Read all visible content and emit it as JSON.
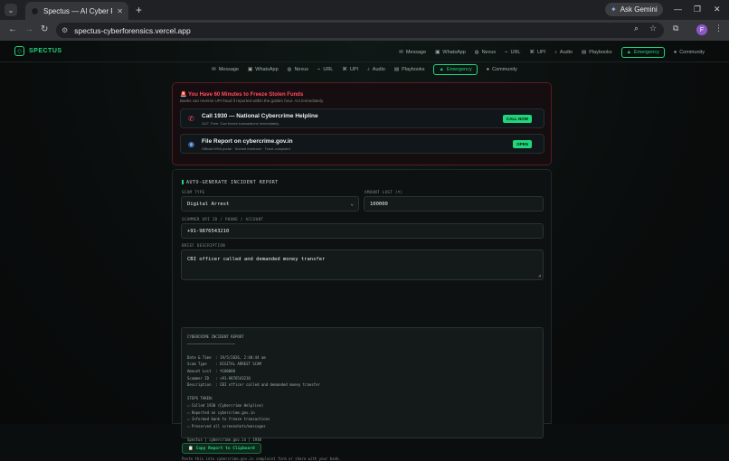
{
  "browser": {
    "tab_title": "Spectus — AI Cyber Forensics P",
    "tab_close": "✕",
    "new_tab": "+",
    "gemini_label": "Ask Gemini",
    "url": "spectus-cyberforensics.vercel.app",
    "profile_initial": "F"
  },
  "app": {
    "logo_icon": "shield",
    "logo_text": "SPECTUS",
    "nav": [
      {
        "icon": "✉",
        "label": "Message"
      },
      {
        "icon": "▣",
        "label": "WhatsApp"
      },
      {
        "icon": "◍",
        "label": "Nexus"
      },
      {
        "icon": "⌁",
        "label": "URL"
      },
      {
        "icon": "⌘",
        "label": "UPI"
      },
      {
        "icon": "♪",
        "label": "Audio"
      },
      {
        "icon": "▤",
        "label": "Playbooks"
      },
      {
        "icon": "▲",
        "label": "Emergency",
        "active": true
      },
      {
        "icon": "●",
        "label": "Community"
      }
    ],
    "subnav": [
      {
        "icon": "✉",
        "label": "Message"
      },
      {
        "icon": "▣",
        "label": "WhatsApp"
      },
      {
        "icon": "◍",
        "label": "Nexus"
      },
      {
        "icon": "⌁",
        "label": "URL"
      },
      {
        "icon": "⌘",
        "label": "UPI"
      },
      {
        "icon": "♪",
        "label": "Audio"
      },
      {
        "icon": "▤",
        "label": "Playbooks"
      },
      {
        "icon": "▲",
        "label": "Emergency",
        "active": true
      },
      {
        "icon": "●",
        "label": "Community"
      }
    ]
  },
  "alert": {
    "heading": "You Have 60 Minutes to Freeze Stolen Funds",
    "sub": "Banks can reverse UPI fraud if reported within the golden hour. Act immediately.",
    "actions": [
      {
        "icon": "phone-icon",
        "title": "Call 1930 — National Cybercrime Helpline",
        "desc": "24/7. Free. Can freeze transactions immediately.",
        "button": "CALL NOW"
      },
      {
        "icon": "globe-icon",
        "title": "File Report on cybercrime.gov.in",
        "desc": "Official MHA portal · Submit evidence · Track complaint",
        "button": "OPEN"
      }
    ]
  },
  "report": {
    "heading": "AUTO-GENERATE INCIDENT REPORT",
    "scam_type_label": "SCAM TYPE",
    "scam_type_value": "Digital Arrest",
    "amount_label": "AMOUNT LOST (₹)",
    "amount_value": "100000",
    "scammer_label": "SCAMMER UPI ID / PHONE / ACCOUNT",
    "scammer_value": "+91-9876543210",
    "desc_label": "BRIEF DESCRIPTION",
    "desc_value": "CBI officer called and demanded money transfer",
    "output_lines": [
      "CYBERCRIME INCIDENT REPORT",
      "──────────────────────",
      "",
      "Date & Time  : 19/5/2026, 2:48:44 am",
      "Scam Type    : DIGITAL ARREST SCAM",
      "Amount Lost  : ₹100000",
      "Scammer ID   : +91-9876543210",
      "Description  : CBI officer called and demanded money transfer",
      "",
      "STEPS TAKEN:",
      "☐ Called 1930 (Cybercrime Helpline)",
      "☐ Reported on cybercrime.gov.in",
      "☐ Informed bank to freeze transactions",
      "☐ Preserved all screenshots/messages",
      "",
      "Spectus | cybercrime.gov.in | 1930"
    ],
    "copy_button": "Copy Report to Clipboard",
    "footer_note": "Paste this into cybercrime.gov.in complaint form or share with your bank."
  }
}
